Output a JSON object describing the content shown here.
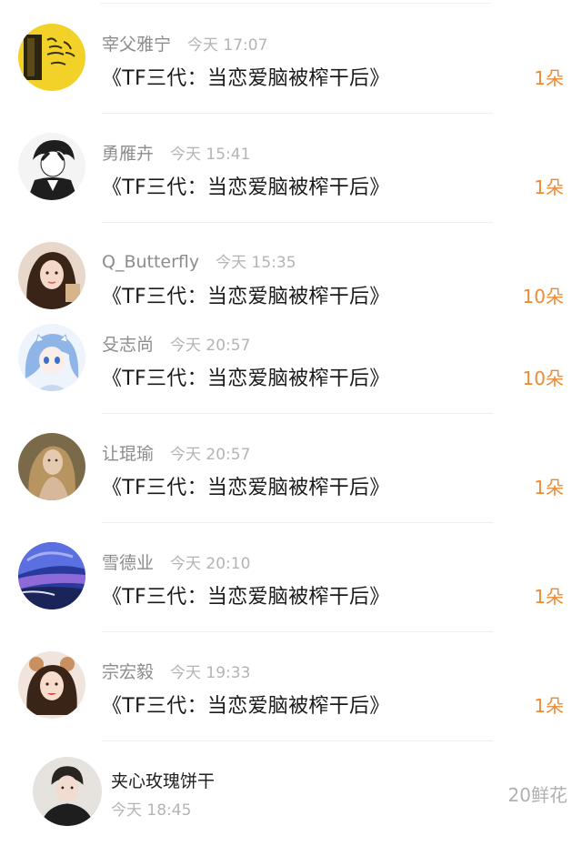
{
  "gifts": [
    {
      "name": "宰父雅宁",
      "time": "今天 17:07",
      "title": "《TF三代：当恋爱脑被榨干后》",
      "count": "1朵",
      "avatar_icon": "yellow-handwriting-avatar-icon",
      "avatar_color": "#f2d128"
    },
    {
      "name": "勇雁卉",
      "time": "今天 15:41",
      "title": "《TF三代：当恋爱脑被榨干后》",
      "count": "1朵",
      "avatar_icon": "anime-boy-avatar-icon",
      "avatar_color": "#1e1e1e"
    },
    {
      "name": "Q_Butterfly",
      "time": "今天 15:35",
      "title": "《TF三代：当恋爱脑被榨干后》",
      "count": "10朵",
      "avatar_icon": "girl-portrait-avatar-icon",
      "avatar_color": "#c9a58c"
    },
    {
      "name": "殳志尚",
      "time": "今天 20:57",
      "title": "《TF三代：当恋爱脑被榨干后》",
      "count": "10朵",
      "avatar_icon": "anime-girl-avatar-icon",
      "avatar_color": "#8fb4e6"
    },
    {
      "name": "让琨瑜",
      "time": "今天 20:57",
      "title": "《TF三代：当恋爱脑被榨干后》",
      "count": "1朵",
      "avatar_icon": "woman-portrait-avatar-icon",
      "avatar_color": "#9c8a6a"
    },
    {
      "name": "雪德业",
      "time": "今天 20:10",
      "title": "《TF三代：当恋爱脑被榨干后》",
      "count": "1朵",
      "avatar_icon": "night-sky-avatar-icon",
      "avatar_color": "#3a4fb8"
    },
    {
      "name": "宗宏毅",
      "time": "今天 19:33",
      "title": "《TF三代：当恋爱脑被榨干后》",
      "count": "1朵",
      "avatar_icon": "girl-with-bear-ears-avatar-icon",
      "avatar_color": "#e6c6b4"
    }
  ],
  "last": {
    "name": "夹心玫瑰饼干",
    "time": "今天 18:45",
    "count": "20鲜花",
    "avatar_icon": "boy-portrait-avatar-icon",
    "avatar_color": "#d8d2cc"
  },
  "colors": {
    "accent": "#ed8a32",
    "muted": "#b0b0b0"
  }
}
